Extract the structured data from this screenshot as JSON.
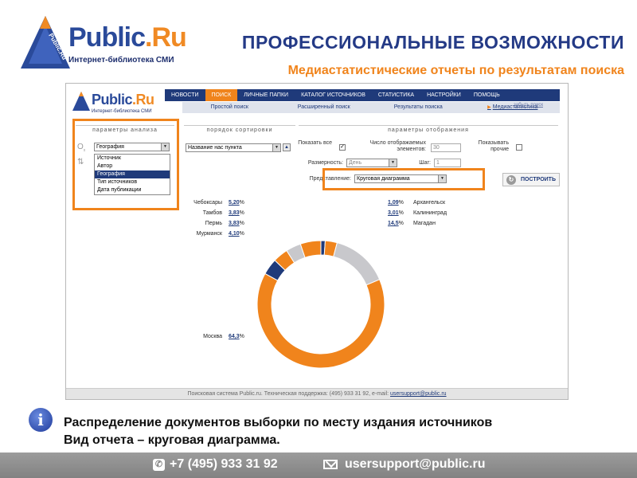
{
  "slide": {
    "logo_word": "Public",
    "logo_dot": ".Ru",
    "logo_subtitle": "Интернет-библиотека СМИ",
    "logo_tag": "Public.Ru",
    "title": "ПРОФЕССИОНАЛЬНЫЕ ВОЗМОЖНОСТИ",
    "subtitle": "Медиастатистические отчеты по результатам поиска",
    "caption_line1": "Распределение документов выборки по месту издания источников",
    "caption_line2": "Вид отчета – круговая диаграмма."
  },
  "app": {
    "logo_word": "Public",
    "logo_dot": ".Ru",
    "logo_subtitle": "Интернет-библиотека СМИ",
    "nav": [
      "НОВОСТИ",
      "ПОИСК",
      "ЛИЧНЫЕ ПАПКИ",
      "КАТАЛОГ ИСТОЧНИКОВ",
      "СТАТИСТИКА",
      "НАСТРОЙКИ",
      "ПОМОЩЬ"
    ],
    "nav_active_index": 1,
    "subnav": [
      "Простой поиск",
      "Расширенный поиск",
      "Результаты поиска",
      "Медиастатистика"
    ],
    "subnav_active_index": 3,
    "forget_link": "забыть поиск",
    "analysis_header": "параметры анализа",
    "sort_header": "порядок сортировки",
    "display_header": "параметры отображения",
    "analysis_select": "География",
    "analysis_options": [
      "Источник",
      "Автор",
      "География",
      "Тип источников",
      "Дата публикации"
    ],
    "analysis_selected_index": 2,
    "sort_select": "Название нас пункта",
    "show_all_label": "Показать все",
    "show_all_checked": true,
    "count_label": "Число отображаемых элементов:",
    "count_value": "30",
    "show_other_label": "Показывать прочие",
    "show_other_checked": false,
    "dimension_label": "Размерность:",
    "dimension_value": "День",
    "step_label": "Шаг:",
    "step_value": "1",
    "representation_label": "Представление:",
    "representation_value": "Круговая диаграмма",
    "build_button": "ПОСТРОИТЬ",
    "footer_text": "Поисковая система Public.ru. Техническая поддержка: (495) 933 31 92, e-mail: ",
    "footer_email": "usersupport@public.ru"
  },
  "chart_data": {
    "type": "pie",
    "style": "donut",
    "categories": [
      "Чебоксары",
      "Тамбов",
      "Пермь",
      "Мурманск",
      "Москва",
      "Архангельск",
      "Калининград",
      "Магадан"
    ],
    "values": [
      5.2,
      3.83,
      3.83,
      4.1,
      64.3,
      1.09,
      3.01,
      14.5
    ],
    "value_labels": [
      "5,20",
      "3,83",
      "3,83",
      "4,10",
      "64,3",
      "1,09",
      "3,01",
      "14,5"
    ],
    "unit": "%",
    "colors": {
      "orange": "#f0841c",
      "navy": "#1f3a7a",
      "gray": "#c8c8cc"
    }
  },
  "contacts": {
    "phone": "+7 (495) 933 31 92",
    "email": "usersupport@public.ru"
  }
}
